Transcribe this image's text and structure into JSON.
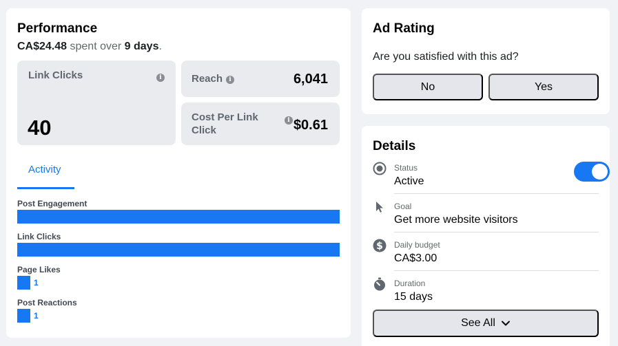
{
  "performance": {
    "title": "Performance",
    "spent": "CA$24.48",
    "spent_mid": " spent over ",
    "days": "9 days",
    "period": ".",
    "metrics": {
      "link_clicks": {
        "label": "Link Clicks",
        "value": "40"
      },
      "reach": {
        "label": "Reach",
        "value": "6,041"
      },
      "cost_per_link_click": {
        "label": "Cost Per Link Click",
        "value": "$0.61"
      }
    },
    "tab_label": "Activity",
    "activity": [
      {
        "label": "Post Engagement",
        "fraction": 1.0,
        "count": ""
      },
      {
        "label": "Link Clicks",
        "fraction": 1.0,
        "count": ""
      },
      {
        "label": "Page Likes",
        "fraction": 0.04,
        "count": "1"
      },
      {
        "label": "Post Reactions",
        "fraction": 0.04,
        "count": "1"
      }
    ]
  },
  "ad_rating": {
    "title": "Ad Rating",
    "question": "Are you satisfied with this ad?",
    "no_label": "No",
    "yes_label": "Yes"
  },
  "details": {
    "title": "Details",
    "status": {
      "label": "Status",
      "value": "Active",
      "icon": "radio-status-icon",
      "toggle_on": true
    },
    "goal": {
      "label": "Goal",
      "value": "Get more website visitors",
      "icon": "cursor-icon"
    },
    "budget": {
      "label": "Daily budget",
      "value": "CA$3.00",
      "icon": "dollar-icon"
    },
    "duration": {
      "label": "Duration",
      "value": "15 days",
      "icon": "stopwatch-icon"
    },
    "see_all_label": "See All"
  },
  "colors": {
    "accent": "#1877f2",
    "metric_bg": "#e9ebee",
    "button_bg": "#e4e6eb",
    "page_bg": "#f0f2f5"
  }
}
